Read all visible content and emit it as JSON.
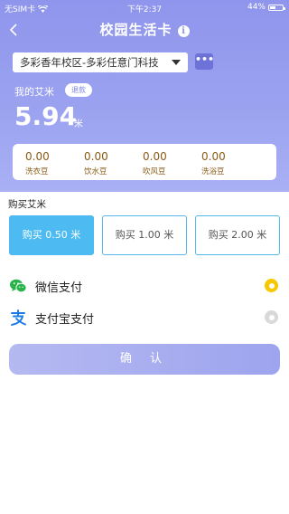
{
  "status_bar": {
    "carrier": "无SIM卡",
    "time": "下午2:37",
    "battery": "44%"
  },
  "header": {
    "title": "校园生活卡",
    "info_icon": "info-icon",
    "back_icon": "chevron-left-icon"
  },
  "campus_select": {
    "value": "多彩香年校区-多彩任意门科技",
    "more_label": "•••"
  },
  "balance": {
    "label": "我的艾米",
    "refund_label": "退款",
    "amount": "5.94",
    "unit": "米"
  },
  "beans": [
    {
      "value": "0.00",
      "name": "洗衣豆"
    },
    {
      "value": "0.00",
      "name": "饮水豆"
    },
    {
      "value": "0.00",
      "name": "吹风豆"
    },
    {
      "value": "0.00",
      "name": "洗浴豆"
    }
  ],
  "purchase": {
    "label": "购买艾米",
    "options": [
      {
        "label": "购买 0.50 米",
        "selected": true
      },
      {
        "label": "购买 1.00 米",
        "selected": false
      },
      {
        "label": "购买 2.00 米",
        "selected": false
      }
    ]
  },
  "payment": [
    {
      "label": "微信支付",
      "icon": "wechat-icon",
      "selected": true
    },
    {
      "label": "支付宝支付",
      "icon": "alipay-icon",
      "selected": false
    }
  ],
  "confirm_label": "确 认",
  "colors": {
    "hero": "#9399ee",
    "selected_option": "#4dbbf1",
    "radio_on": "#f7c800",
    "bean_text": "#8a5a13"
  }
}
